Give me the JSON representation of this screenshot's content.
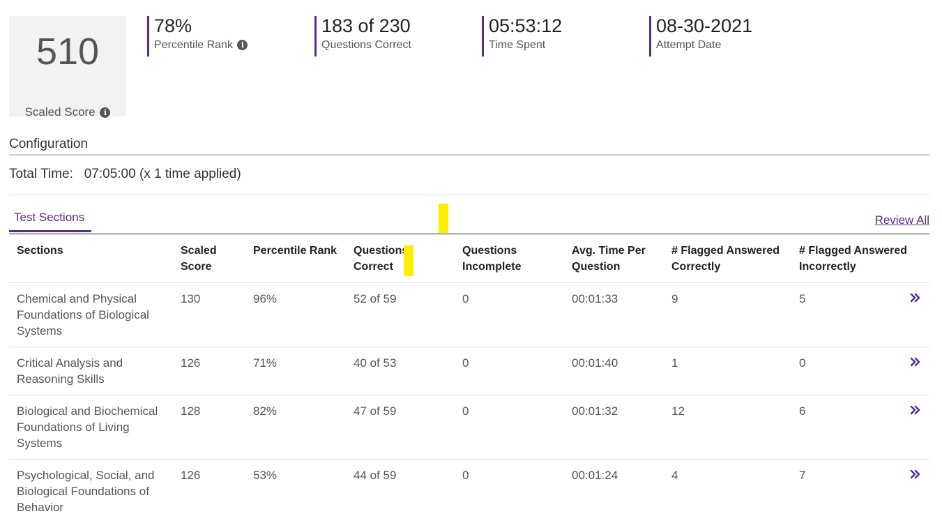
{
  "score": {
    "value": "510",
    "label": "Scaled Score"
  },
  "stats": [
    {
      "value": "78%",
      "label": "Percentile Rank"
    },
    {
      "value": "183 of 230",
      "label": "Questions Correct"
    },
    {
      "value": "05:53:12",
      "label": "Time Spent"
    },
    {
      "value": "08-30-2021",
      "label": "Attempt Date"
    }
  ],
  "configuration": {
    "title": "Configuration",
    "total_time_label": "Total Time:",
    "total_time_value": "07:05:00 (x 1 time applied)"
  },
  "tabs": {
    "active": "Test Sections",
    "review_all": "Review All"
  },
  "table": {
    "headers": [
      "Sections",
      "Scaled\nScore",
      "Percentile Rank",
      "Questions\nCorrect",
      "Questions\nIncomplete",
      "Avg. Time Per\nQuestion",
      "# Flagged Answered\nCorrectly",
      "# Flagged Answered\nIncorrectly"
    ],
    "rows": [
      {
        "section": "Chemical and Physical Foundations of Biological Systems",
        "scaled": "130",
        "percentile": "96%",
        "correct": "52 of 59",
        "incomplete": "0",
        "avg_time": "00:01:33",
        "flag_correct": "9",
        "flag_incorrect": "5"
      },
      {
        "section": "Critical Analysis and Reasoning Skills",
        "scaled": "126",
        "percentile": "71%",
        "correct": "40 of 53",
        "incomplete": "0",
        "avg_time": "00:01:40",
        "flag_correct": "1",
        "flag_incorrect": "0"
      },
      {
        "section": "Biological and Biochemical Foundations of Living Systems",
        "scaled": "128",
        "percentile": "82%",
        "correct": "47 of 59",
        "incomplete": "0",
        "avg_time": "00:01:32",
        "flag_correct": "12",
        "flag_incorrect": "6"
      },
      {
        "section": "Psychological, Social, and Biological Foundations of Behavior",
        "scaled": "126",
        "percentile": "53%",
        "correct": "44 of 59",
        "incomplete": "0",
        "avg_time": "00:01:24",
        "flag_correct": "4",
        "flag_incorrect": "7"
      }
    ]
  },
  "colors": {
    "accent": "#5b2d86",
    "highlight": "#ffee00",
    "score_bg": "#f2f2f2"
  },
  "icons": {
    "info": "info-circle-icon",
    "row_action": "double-chevron-right-icon"
  }
}
